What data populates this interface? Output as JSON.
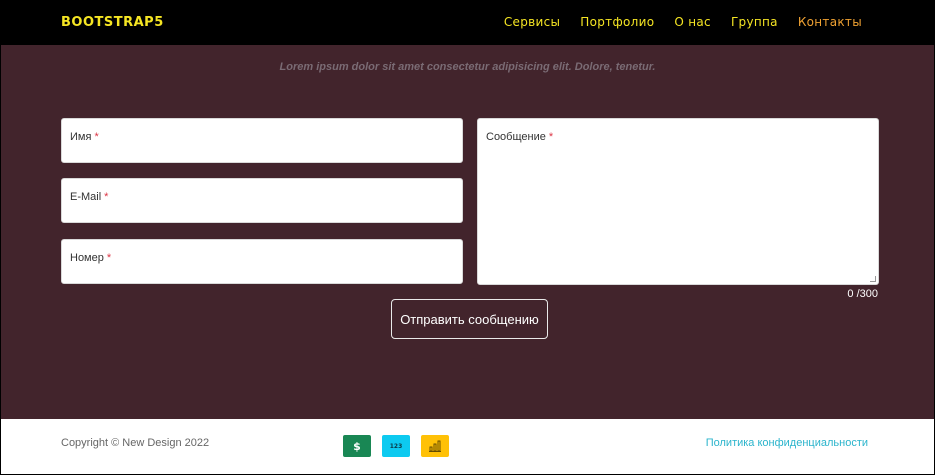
{
  "navbar": {
    "brand": "BOOTSTRAP5",
    "items": [
      {
        "label": "Сервисы"
      },
      {
        "label": "Портфолио"
      },
      {
        "label": "О нас"
      },
      {
        "label": "Группа"
      },
      {
        "label": "Контакты"
      }
    ],
    "active_index": 4
  },
  "lead_text": "Lorem ipsum dolor sit amet consectetur adipisicing elit. Dolore, tenetur.",
  "form": {
    "name_label": "Имя",
    "email_label": "E-Mail",
    "phone_label": "Номер",
    "message_label": "Сообщение",
    "required_mark": "*",
    "counter": "0 /300",
    "submit_label": "Отправить сообщению"
  },
  "footer": {
    "copyright": "Copyright © New Design 2022",
    "badges": [
      {
        "text": "$",
        "icon": "dollar-icon",
        "color": "#198754"
      },
      {
        "text": "123",
        "icon": "numbers-icon",
        "color": "#0dcaf0"
      },
      {
        "text": "",
        "icon": "chart-icon",
        "color": "#ffc107"
      }
    ],
    "privacy_link": "Политика конфиденциальности"
  },
  "colors": {
    "background": "#42242c",
    "navbar": "#000000",
    "brand_accent": "#f5e523",
    "active_link": "#f0a232",
    "required": "#dc3545",
    "privacy_link": "#2ab4cc"
  }
}
